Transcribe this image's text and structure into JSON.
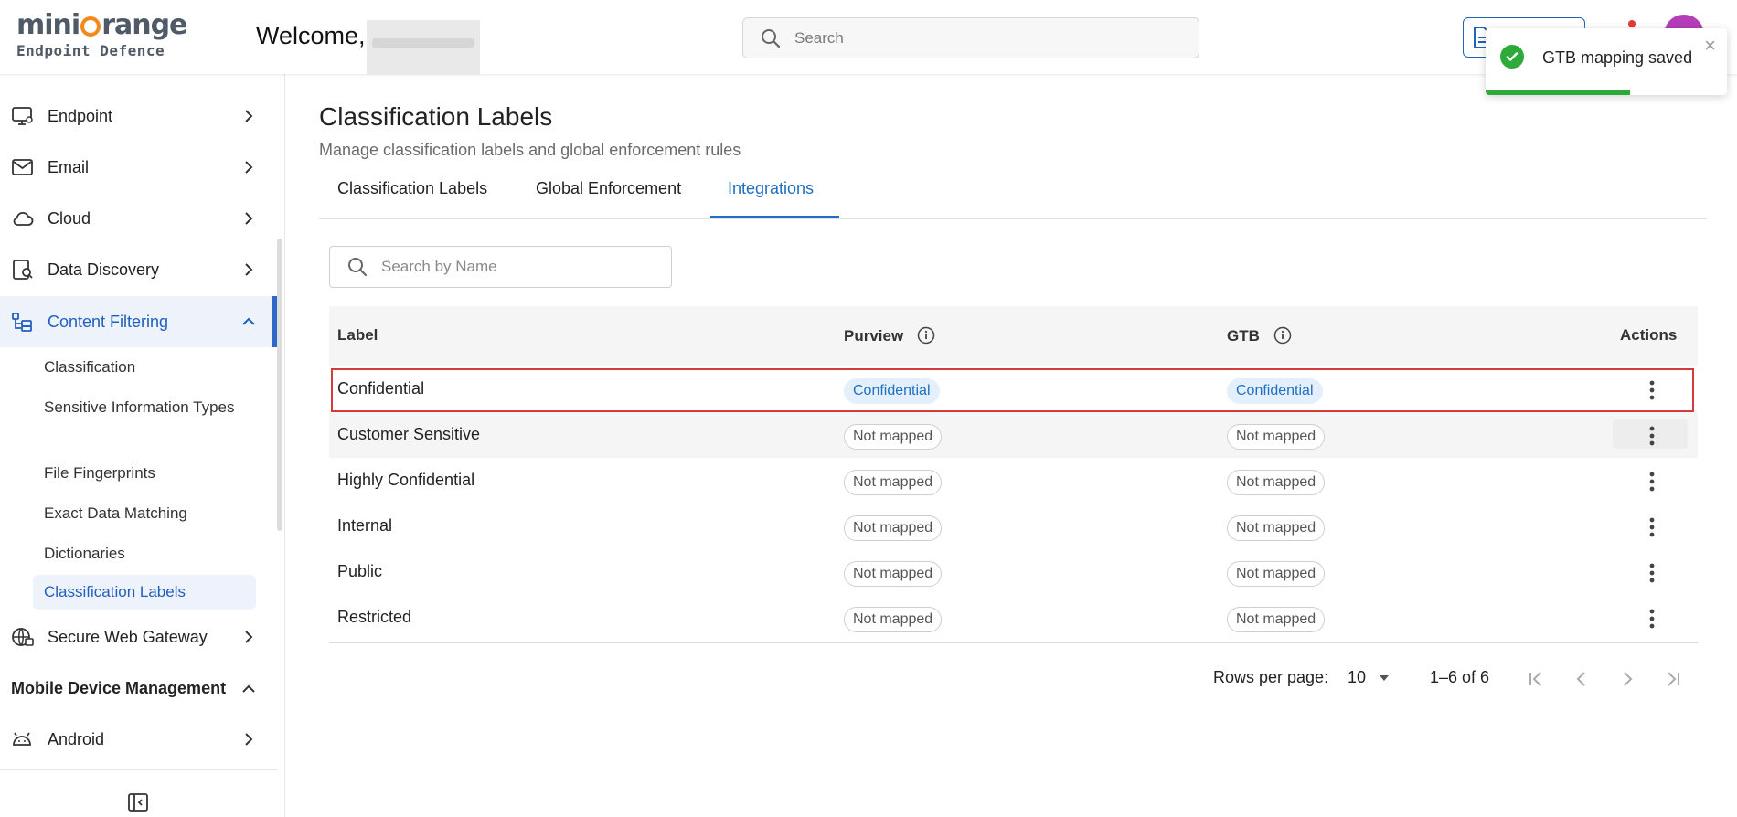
{
  "header": {
    "brand_name": "miniOrange",
    "brand_sub": "Endpoint Defence",
    "welcome": "Welcome,",
    "search_placeholder": "Search"
  },
  "toast": {
    "message": "GTB mapping saved",
    "progress": 0.6
  },
  "sidebar": {
    "items": [
      {
        "label": "Endpoint",
        "icon": "monitor-icon"
      },
      {
        "label": "Email",
        "icon": "mail-icon"
      },
      {
        "label": "Cloud",
        "icon": "cloud-icon"
      },
      {
        "label": "Data Discovery",
        "icon": "data-discovery-icon"
      },
      {
        "label": "Content Filtering",
        "icon": "content-filtering-icon"
      }
    ],
    "sub_items": [
      "Classification",
      "Sensitive Information Types",
      "File Fingerprints",
      "Exact Data Matching",
      "Dictionaries",
      "Classification Labels"
    ],
    "secure_web_gateway": "Secure Web Gateway",
    "section_mdm": "Mobile Device Management",
    "android": "Android"
  },
  "main": {
    "title": "Classification Labels",
    "subtitle": "Manage classification labels and global enforcement rules",
    "tabs": [
      "Classification Labels",
      "Global Enforcement",
      "Integrations"
    ],
    "active_tab": "Integrations",
    "search_placeholder": "Search by Name"
  },
  "table": {
    "columns": [
      "Label",
      "Purview",
      "GTB",
      "Actions"
    ],
    "rows": [
      {
        "label": "Confidential",
        "purview": "Confidential",
        "gtb": "Confidential",
        "mapped": true
      },
      {
        "label": "Customer Sensitive",
        "purview": "Not mapped",
        "gtb": "Not mapped",
        "mapped": false
      },
      {
        "label": "Highly Confidential",
        "purview": "Not mapped",
        "gtb": "Not mapped",
        "mapped": false
      },
      {
        "label": "Internal",
        "purview": "Not mapped",
        "gtb": "Not mapped",
        "mapped": false
      },
      {
        "label": "Public",
        "purview": "Not mapped",
        "gtb": "Not mapped",
        "mapped": false
      },
      {
        "label": "Restricted",
        "purview": "Not mapped",
        "gtb": "Not mapped",
        "mapped": false
      }
    ]
  },
  "pagination": {
    "rows_per_page_label": "Rows per page:",
    "rows_per_page": "10",
    "range": "1–6 of 6"
  },
  "colors": {
    "accent": "#1f6fc2",
    "brand_orange": "#f28a1b",
    "success": "#2eaa3a",
    "highlight": "#d63a3a"
  }
}
